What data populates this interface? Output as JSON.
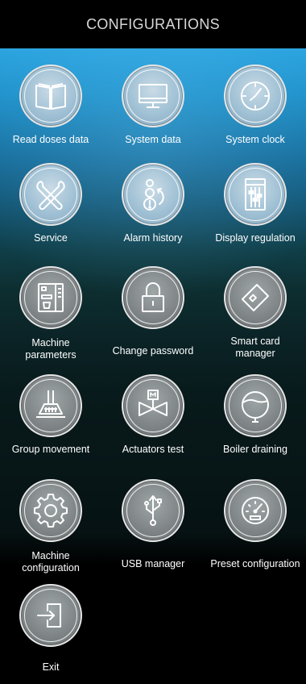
{
  "header": {
    "title": "CONFIGURATIONS"
  },
  "tiles": [
    {
      "label": "Read doses data",
      "icon": "book-icon"
    },
    {
      "label": "System data",
      "icon": "monitor-icon"
    },
    {
      "label": "System clock",
      "icon": "clock-icon"
    },
    {
      "label": "Service",
      "icon": "tools-icon"
    },
    {
      "label": "Alarm history",
      "icon": "alarm-icon"
    },
    {
      "label": "Display regulation",
      "icon": "sliders-icon"
    },
    {
      "label": "Machine\nparameters",
      "icon": "coffee-machine-icon"
    },
    {
      "label": "Change password",
      "icon": "padlock-icon"
    },
    {
      "label": "Smart card\nmanager",
      "icon": "smart-card-icon"
    },
    {
      "label": "Group movement",
      "icon": "brew-group-icon"
    },
    {
      "label": "Actuators test",
      "icon": "valve-icon"
    },
    {
      "label": "Boiler draining",
      "icon": "boiler-icon"
    },
    {
      "label": "Machine\nconfiguration",
      "icon": "gear-icon"
    },
    {
      "label": "USB manager",
      "icon": "usb-icon"
    },
    {
      "label": "Preset configuration",
      "icon": "speedometer-icon"
    },
    {
      "label": "Exit",
      "icon": "exit-icon"
    }
  ]
}
